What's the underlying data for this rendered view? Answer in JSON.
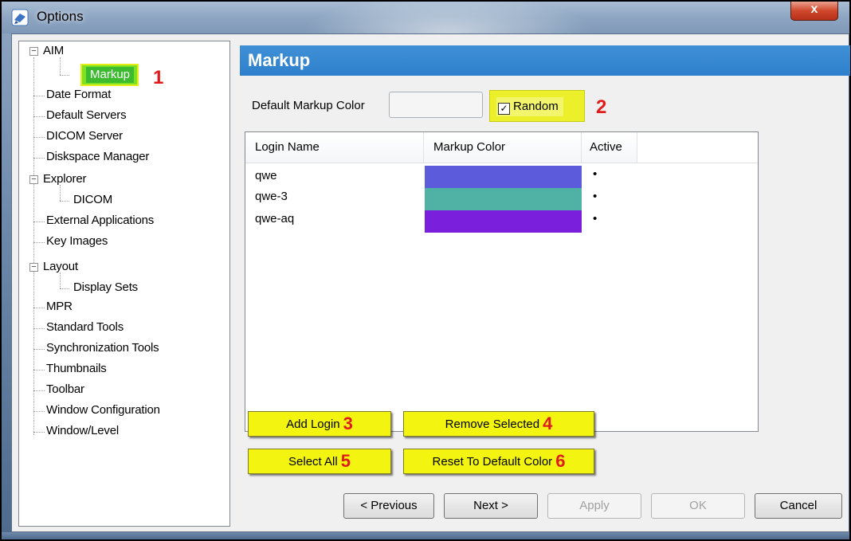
{
  "window": {
    "title": "Options",
    "close_label": "x"
  },
  "tree": {
    "items": [
      {
        "label": "AIM"
      },
      {
        "label": "Markup"
      },
      {
        "label": "Date Format"
      },
      {
        "label": "Default Servers"
      },
      {
        "label": "DICOM Server"
      },
      {
        "label": "Diskspace Manager"
      },
      {
        "label": "Explorer"
      },
      {
        "label": "DICOM"
      },
      {
        "label": "External Applications"
      },
      {
        "label": "Key Images"
      },
      {
        "label": "Layout"
      },
      {
        "label": "Display Sets"
      },
      {
        "label": "MPR"
      },
      {
        "label": "Standard Tools"
      },
      {
        "label": "Synchronization Tools"
      },
      {
        "label": "Thumbnails"
      },
      {
        "label": "Toolbar"
      },
      {
        "label": "Window Configuration"
      },
      {
        "label": "Window/Level"
      }
    ],
    "expander_symbol": "−"
  },
  "panel": {
    "title": "Markup",
    "default_color_label": "Default Markup Color",
    "random_label": "Random",
    "random_checked": true,
    "check_glyph": "✓"
  },
  "table": {
    "columns": [
      "Login Name",
      "Markup Color",
      "Active"
    ],
    "rows": [
      {
        "login": "qwe",
        "color": "#5b5bdb",
        "active": "•"
      },
      {
        "login": "qwe-3",
        "color": "#4fb2a5",
        "active": "•"
      },
      {
        "login": "qwe-aq",
        "color": "#7a1fdc",
        "active": "•"
      }
    ]
  },
  "actions": {
    "add_login": "Add Login",
    "remove_selected": "Remove Selected",
    "select_all": "Select All",
    "reset_default": "Reset To Default Color"
  },
  "annotations": [
    "1",
    "2",
    "3",
    "4",
    "5",
    "6"
  ],
  "footer": {
    "previous": "< Previous",
    "next": "Next >",
    "apply": "Apply",
    "ok": "OK",
    "cancel": "Cancel"
  },
  "colors": {
    "header_blue": "#3189d0",
    "highlight_yellow": "#f3f410",
    "annotation_red": "#e01b1b",
    "selected_green": "#3bbb2d"
  }
}
